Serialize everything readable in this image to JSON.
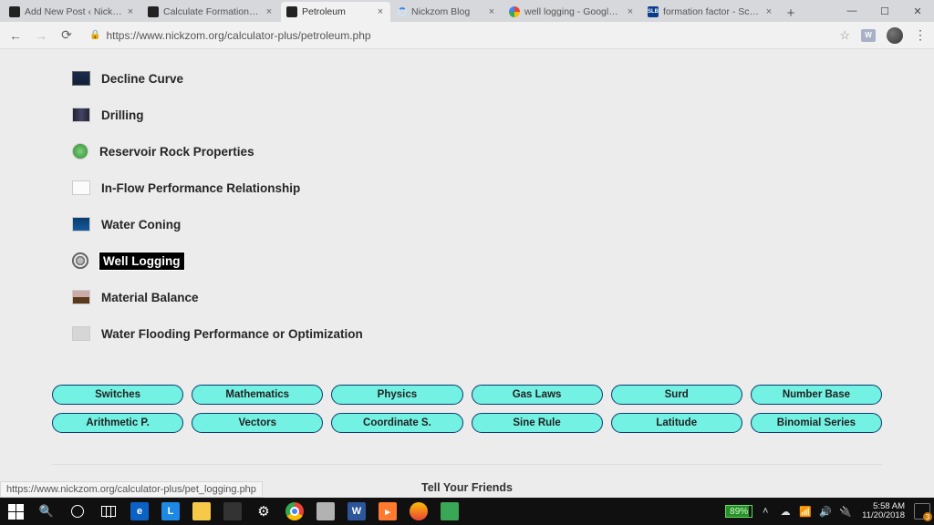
{
  "tabs": [
    {
      "title": "Add New Post ‹ Nickzo…",
      "fav": "#222"
    },
    {
      "title": "Calculate Formation Fa…",
      "fav": "#222"
    },
    {
      "title": "Petroleum",
      "fav": "#222",
      "active": true
    },
    {
      "title": "Nickzom Blog",
      "fav": "spinner"
    },
    {
      "title": "well logging - Google S…",
      "fav": "google"
    },
    {
      "title": "formation factor - Schlu…",
      "fav": "slb"
    }
  ],
  "url": "https://www.nickzom.org/calculator-plus/petroleum.php",
  "categories": [
    {
      "label": "Decline Curve",
      "icon": "ci-dark"
    },
    {
      "label": "Drilling",
      "icon": "ci-drill"
    },
    {
      "label": "Reservoir Rock Properties",
      "icon": "ci-green"
    },
    {
      "label": "In-Flow Performance Relationship",
      "icon": "ci-flow"
    },
    {
      "label": "Water Coning",
      "icon": "ci-waterc"
    },
    {
      "label": "Well Logging",
      "icon": "ci-welllog",
      "highlight": true
    },
    {
      "label": "Material Balance",
      "icon": "ci-mat"
    },
    {
      "label": "Water Flooding Performance or Optimization",
      "icon": "ci-wf"
    }
  ],
  "buttons_row1": [
    "Switches",
    "Mathematics",
    "Physics",
    "Gas Laws",
    "Surd",
    "Number Base"
  ],
  "buttons_row2": [
    "Arithmetic P.",
    "Vectors",
    "Coordinate S.",
    "Sine Rule",
    "Latitude",
    "Binomial Series"
  ],
  "tell_friends": "Tell Your Friends",
  "social_colors": [
    "#4bbf4b",
    "#3b5998",
    "#4aa3eb",
    "#e2574c",
    "#e2574c",
    "#e2574c"
  ],
  "status_url": "https://www.nickzom.org/calculator-plus/pet_logging.php",
  "battery": "89%",
  "time": "5:58 AM",
  "date": "11/20/2018"
}
